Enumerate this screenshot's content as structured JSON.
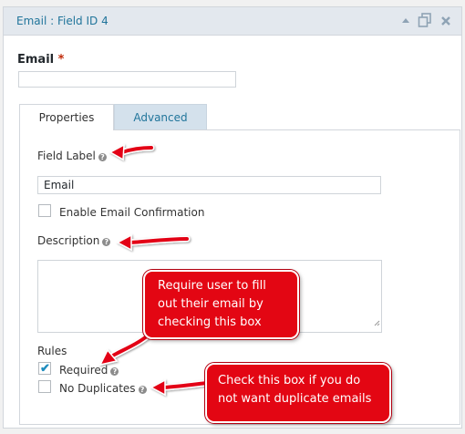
{
  "header": {
    "title": "Email : Field ID 4"
  },
  "field_preview": {
    "label": "Email",
    "required_marker": "*",
    "value": ""
  },
  "tabs": [
    {
      "label": "Properties",
      "active": true
    },
    {
      "label": "Advanced",
      "active": false
    }
  ],
  "properties": {
    "field_label_title": "Field Label",
    "field_label_value": "Email",
    "enable_confirmation_label": "Enable Email Confirmation",
    "enable_confirmation_checked": false,
    "description_title": "Description",
    "description_value": "",
    "rules_title": "Rules",
    "required_label": "Required",
    "required_checked": true,
    "no_duplicates_label": "No Duplicates",
    "no_duplicates_checked": false
  },
  "callouts": {
    "required_note_lines": [
      "Require user to fill",
      "out their email by",
      "checking this box"
    ],
    "duplicates_note_lines": [
      "Check this box if you do",
      "not want duplicate emails"
    ]
  },
  "colors": {
    "header_bg": "#e3e8ee",
    "link_blue": "#21759b",
    "required_red": "#c02b0a",
    "callout_red": "#e30613",
    "checkmark_blue": "#1e8cbe"
  }
}
